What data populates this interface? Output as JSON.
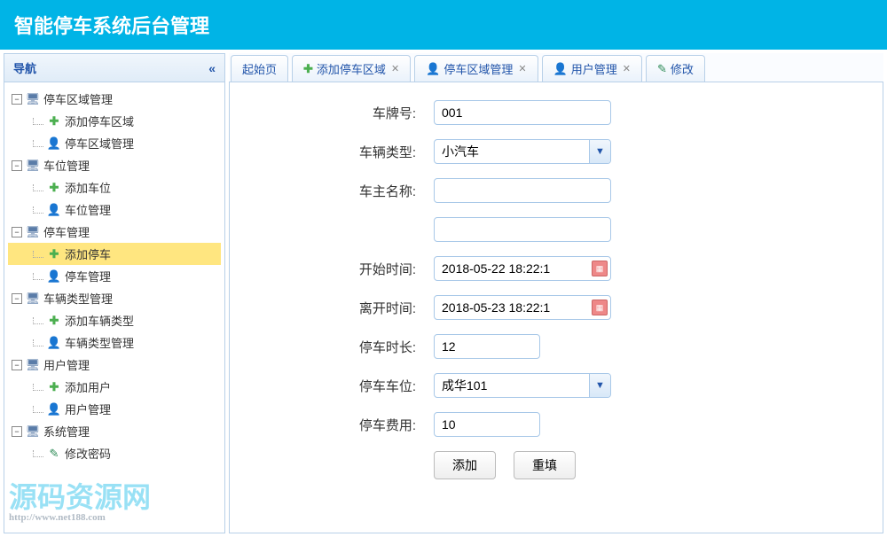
{
  "header": {
    "title": "智能停车系统后台管理"
  },
  "sidebar": {
    "title": "导航",
    "nodes": [
      {
        "label": "停车区域管理",
        "children": [
          {
            "label": "添加停车区域",
            "icon": "add"
          },
          {
            "label": "停车区域管理",
            "icon": "user"
          }
        ]
      },
      {
        "label": "车位管理",
        "children": [
          {
            "label": "添加车位",
            "icon": "add"
          },
          {
            "label": "车位管理",
            "icon": "user"
          }
        ]
      },
      {
        "label": "停车管理",
        "children": [
          {
            "label": "添加停车",
            "icon": "add",
            "selected": true
          },
          {
            "label": "停车管理",
            "icon": "user"
          }
        ]
      },
      {
        "label": "车辆类型管理",
        "children": [
          {
            "label": "添加车辆类型",
            "icon": "add"
          },
          {
            "label": "车辆类型管理",
            "icon": "user"
          }
        ]
      },
      {
        "label": "用户管理",
        "children": [
          {
            "label": "添加用户",
            "icon": "add"
          },
          {
            "label": "用户管理",
            "icon": "user"
          }
        ]
      },
      {
        "label": "系统管理",
        "children": [
          {
            "label": "修改密码",
            "icon": "pencil"
          }
        ]
      }
    ]
  },
  "tabs": [
    {
      "label": "起始页",
      "icon": "",
      "closable": false
    },
    {
      "label": "添加停车区域",
      "icon": "add",
      "closable": true
    },
    {
      "label": "停车区域管理",
      "icon": "user",
      "closable": true
    },
    {
      "label": "用户管理",
      "icon": "user",
      "closable": true
    },
    {
      "label": "修改",
      "icon": "pencil",
      "closable": false
    }
  ],
  "form": {
    "plate_label": "车牌号:",
    "plate_value": "001",
    "type_label": "车辆类型:",
    "type_value": "小汽车",
    "owner_label": "车主名称:",
    "owner_value": "",
    "extra_value": "",
    "start_label": "开始时间:",
    "start_value": "2018-05-22 18:22:1",
    "end_label": "离开时间:",
    "end_value": "2018-05-23 18:22:1",
    "duration_label": "停车时长:",
    "duration_value": "12",
    "slot_label": "停车车位:",
    "slot_value": "成华101",
    "fee_label": "停车费用:",
    "fee_value": "10",
    "submit": "添加",
    "reset": "重填"
  },
  "watermark": {
    "main": "源码资源网",
    "sub": "http://www.net188.com"
  }
}
